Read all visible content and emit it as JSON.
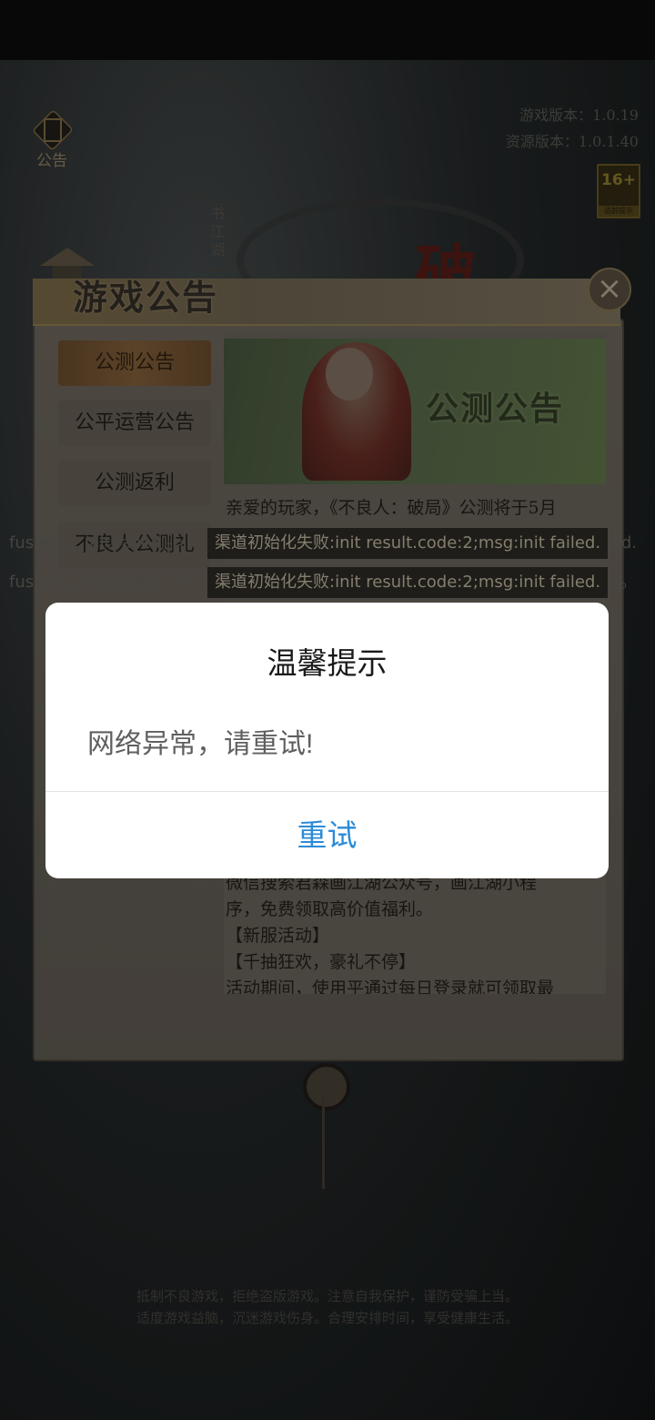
{
  "hud": {
    "notice_label": "公告",
    "game_version": "游戏版本：1.0.19",
    "resource_version": "资源版本：1.0.1.40",
    "age_rating": "16+",
    "age_rating_sub": "适龄提示"
  },
  "logo": {
    "stamp": "书江湖",
    "char": "破"
  },
  "panel": {
    "title": "游戏公告",
    "close": "×",
    "tabs": [
      {
        "label": "公测公告",
        "active": true
      },
      {
        "label": "公平运营公告",
        "active": false
      },
      {
        "label": "公测返利",
        "active": false
      },
      {
        "label": "不良人公测礼",
        "active": false
      }
    ],
    "banner_text": "公测公告",
    "article": {
      "line1": "亲爱的玩家，《不良人：破局》公测将于5月",
      "tail1": "微信搜索君森画江湖公众号，画江湖小程",
      "tail2": "序，免费领取高价值福利。",
      "tail3": "【新服活动】",
      "tail4": "【千抽狂欢，豪礼不停】",
      "tail5": "活动期间，使用平通过每日登录就可领取最"
    }
  },
  "errors": [
    {
      "left": "fusion ... init failed ->",
      "mid": "渠道初始化失败:init result.code:2;msg:init failed.",
      "right": "d."
    },
    {
      "left": "fusion ... init failed ->",
      "mid": "渠道初始化失败:init result.code:2;msg:init failed.",
      "right": "d。"
    }
  ],
  "footer": {
    "line1": "抵制不良游戏，拒绝盗版游戏。注意自我保护，谨防受骗上当。",
    "line2": "适度游戏益脑，沉迷游戏伤身。合理安排时间，享受健康生活。"
  },
  "dialog": {
    "title": "温馨提示",
    "message": "网络异常，请重试!",
    "button": "重试"
  },
  "colors": {
    "dialog_button": "#2b8bd8",
    "panel_bg": "#5d5850"
  }
}
